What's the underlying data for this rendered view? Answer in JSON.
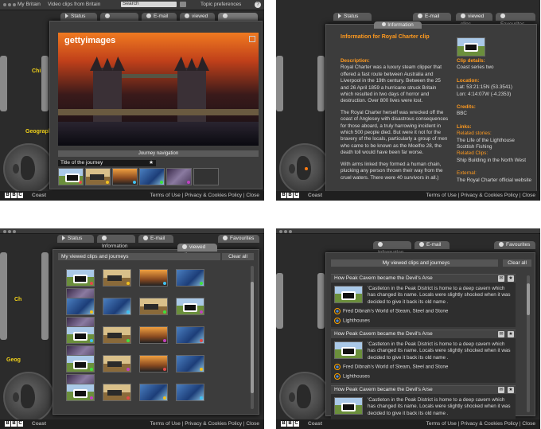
{
  "common": {
    "bbc_letters": [
      "B",
      "B",
      "C"
    ],
    "coast": "Coast",
    "footer": "Terms of Use | Privacy & Cookies Policy | Close",
    "tabs": {
      "status": "Status",
      "information": "Information",
      "email": "E-mail",
      "viewed": "viewed clips",
      "favourites": "Favourites"
    }
  },
  "panel1": {
    "topbar": {
      "left": "My Britain",
      "middle": "Video clips from Britain",
      "search": "Search",
      "right": "Topic preferences",
      "help": "?"
    },
    "gettyimages": "gettyimages",
    "journey_nav": "Journey navigation",
    "journey_title": "Title of the journey",
    "side_labels": {
      "chi": "Chi",
      "geographic": "Geographi"
    }
  },
  "panel2": {
    "info_tab": "Information",
    "heading": "Information for Royal Charter clip",
    "description_label": "Description:",
    "description": "Royal Charter was a luxury steam clipper that offered a fast route between Australia and Liverpool in the 19th century. Between the 25 and 26 April 1859 a hurricane struck Britain which resulted in two days of horror and destruction. Over 800 lives were lost.",
    "description2": "The Royal Charter herself was wrecked off the coast of Anglesey with disastrous consequences for those aboard, a truly harrowing incident in which 500 people died. But were it not for the bravery of the locals, particularly a group of men who came to be known as the Moelfre 28, the death toll would have been far worse.",
    "description3": "With arms linked they formed a human chain, plucking any person thrown their way from the cruel waters. There were 40 survivors in all.)",
    "clip_details_label": "Clip details:",
    "clip_details": "Coast series two",
    "location_label": "Location:",
    "location1": "Lat: 53:21:15N (53.3541)",
    "location2": "Lon: 4:14:07W (-4.2353)",
    "credits_label": "Credits:",
    "credits": "BBC",
    "links_label": "Links:",
    "related_stories_label": "Related stories:",
    "related_story1": "The Life of the Lighthouse",
    "related_story2": "Scottish Fishing",
    "related_clips_label": "Related Clips:",
    "related_clip1": "Ship Building in the North West",
    "external_label": "External:",
    "external1": "The Royal Charter official website"
  },
  "panel3": {
    "title": "My viewed clips and journeys",
    "clear": "Clear all",
    "side_labels": {
      "ch": "Ch",
      "geog": "Geog"
    },
    "grid": [
      [
        "cow",
        "train",
        "sunset",
        "blue",
        "roof"
      ],
      [
        "blue",
        "blue",
        "train",
        "cow",
        "roof"
      ],
      [
        "cow",
        "train",
        "sunset",
        "blue",
        "roof"
      ],
      [
        "cow",
        "train",
        "sunset",
        "blue",
        "roof"
      ],
      [
        "cow",
        "train",
        "blue",
        "blue"
      ]
    ]
  },
  "panel4": {
    "title": "My viewed clips and journeys",
    "clear": "Clear all",
    "items": [
      {
        "title": "How Peak Cavern became the Devil's Arse",
        "text": "'Castleton in the Peak District is home to a deep cavern which has changed its name. Locals were slightly shocked when it was decided to give it back its old name .",
        "links": [
          "Fred Dibnah's World of Steam, Steel and Stone",
          "Lighthouses"
        ]
      },
      {
        "title": "How Peak Cavern became the Devil's Arse",
        "text": "'Castleton in the Peak District is home to a deep cavern which has changed its name. Locals were slightly shocked when it was decided to give it back its old name .",
        "links": [
          "Fred Dibnah's World of Steam, Steel and Stone",
          "Lighthouses"
        ]
      },
      {
        "title": "How Peak Cavern became the Devil's Arse",
        "text": "'Castleton in the Peak District is home to a deep cavern which has changed its name. Locals were slightly shocked when it was decided to give it back its old name .",
        "links": []
      }
    ]
  },
  "colors": {
    "accent": "#ff9a1f",
    "yellow": "#f2d21a",
    "panel": "#2b2b2b"
  }
}
